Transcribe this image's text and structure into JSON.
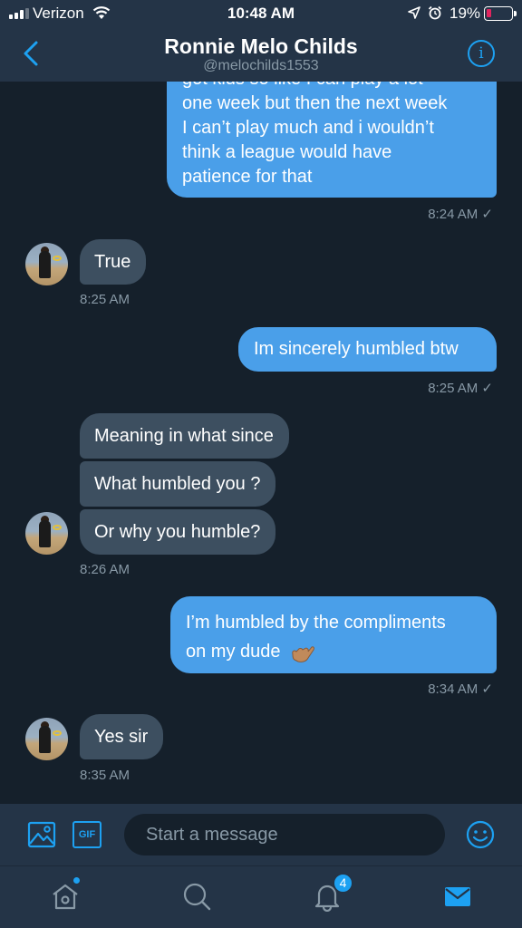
{
  "status_bar": {
    "carrier": "Verizon",
    "time": "10:48 AM",
    "battery_percent": "19%",
    "battery_level": 0.19
  },
  "header": {
    "name": "Ronnie Melo Childs",
    "handle": "@melochilds1553"
  },
  "messages": [
    {
      "direction": "outgoing",
      "lines": [
        "got kids so like I can play a lot",
        "one week but then the next week",
        "I can’t play much and i wouldn’t",
        "think a league would have",
        "patience for that"
      ],
      "time": "8:24 AM ✓"
    },
    {
      "direction": "incoming",
      "lines": [
        "True"
      ],
      "time": "8:25 AM"
    },
    {
      "direction": "outgoing",
      "lines": [
        "Im sincerely humbled btw"
      ],
      "time": "8:25 AM ✓"
    },
    {
      "direction": "incoming",
      "lines": [
        "Meaning in what since"
      ]
    },
    {
      "direction": "incoming",
      "lines": [
        "What humbled you ?"
      ]
    },
    {
      "direction": "incoming",
      "lines": [
        "Or why you humble?"
      ],
      "time": "8:26 AM"
    },
    {
      "direction": "outgoing",
      "lines": [
        "I’m humbled by the compliments",
        "on my dude"
      ],
      "time": "8:34 AM ✓"
    },
    {
      "direction": "incoming",
      "lines": [
        "Yes sir"
      ],
      "time": "8:35 AM"
    }
  ],
  "composer": {
    "placeholder": "Start a message",
    "gif_label": "GIF"
  },
  "tabbar": {
    "notification_count": "4"
  },
  "colors": {
    "background": "#15202b",
    "bar": "#243447",
    "accent": "#1da1f2",
    "outgoing_bubble": "#4a9fe9",
    "incoming_bubble": "#3d4f60"
  }
}
